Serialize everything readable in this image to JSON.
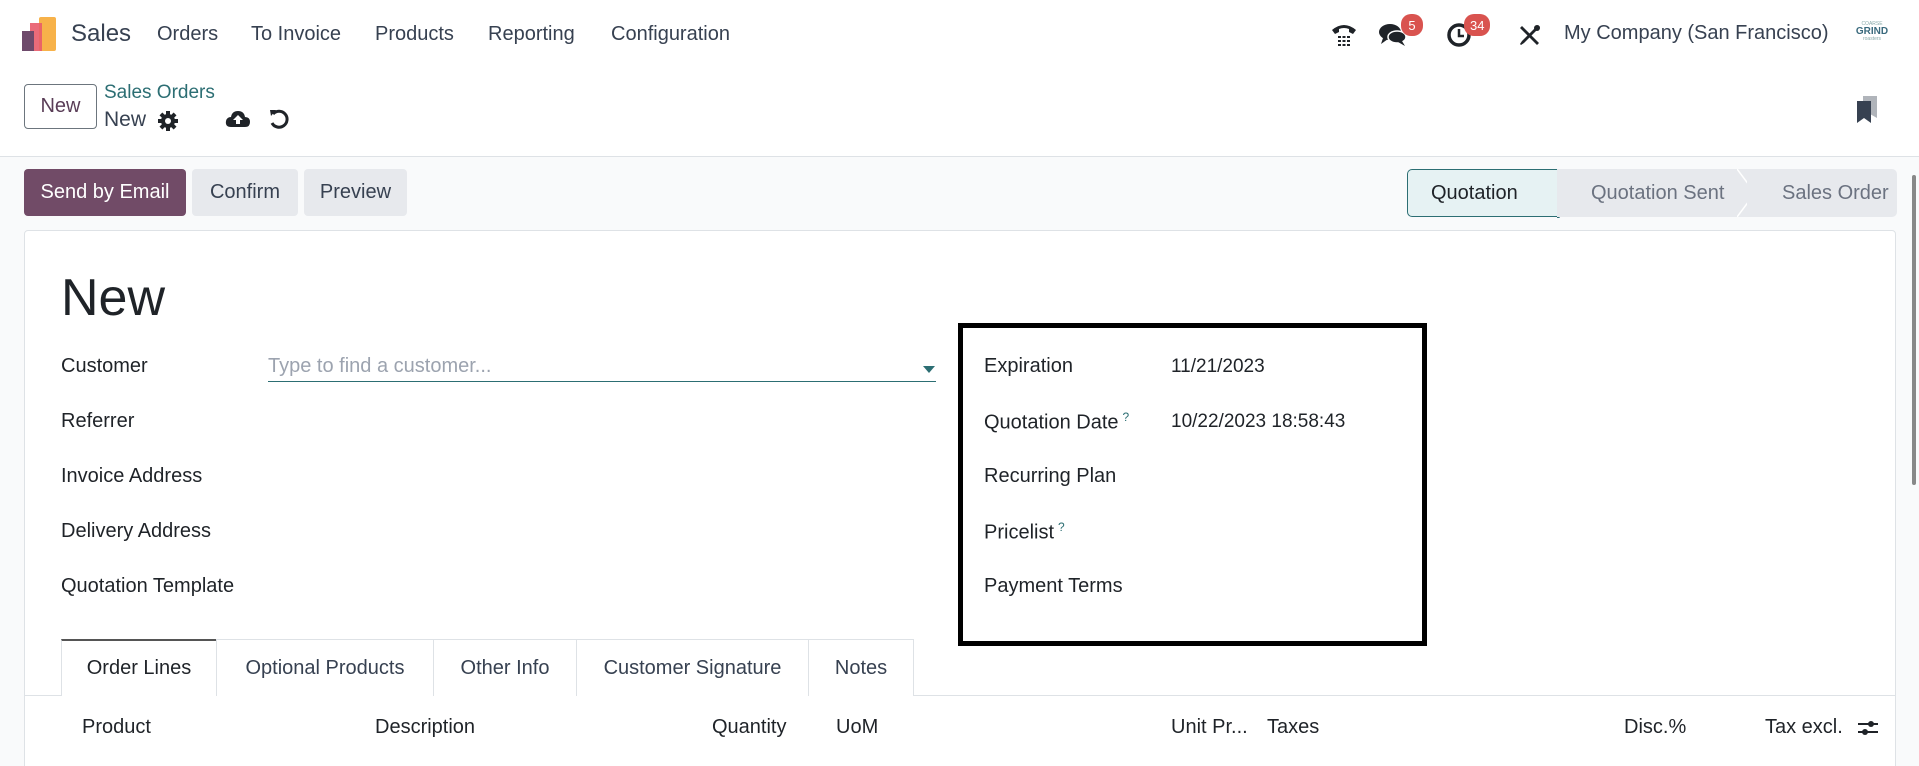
{
  "navbar": {
    "app_name": "Sales",
    "menu": [
      "Orders",
      "To Invoice",
      "Products",
      "Reporting",
      "Configuration"
    ],
    "icons": [
      "phone-icon",
      "chat-icon",
      "activity-clock-icon",
      "debug-tools-icon"
    ],
    "chat_badge": "5",
    "activity_badge": "34",
    "company": "My Company (San Francisco)",
    "user_avatar_text": "GRIND",
    "user_avatar_small_top": "COARSE",
    "user_avatar_small_bottom": "roasters"
  },
  "control_panel": {
    "new_button": "New",
    "breadcrumb_parent": "Sales Orders",
    "breadcrumb_current": "New"
  },
  "actions": {
    "send_email": "Send by Email",
    "confirm": "Confirm",
    "preview": "Preview"
  },
  "statusbar": {
    "steps": [
      "Quotation",
      "Quotation Sent",
      "Sales Order"
    ],
    "active": "Quotation"
  },
  "colors": {
    "primary": "#714b67",
    "accent": "#2c6e73",
    "badge": "#d9534f"
  },
  "form": {
    "title": "New",
    "left_fields": {
      "customer_label": "Customer",
      "customer_placeholder": "Type to find a customer...",
      "referrer_label": "Referrer",
      "invoice_address_label": "Invoice Address",
      "delivery_address_label": "Delivery Address",
      "quotation_template_label": "Quotation Template"
    },
    "right_fields": {
      "expiration_label": "Expiration",
      "expiration_value": "11/21/2023",
      "quotation_date_label": "Quotation Date",
      "quotation_date_value": "10/22/2023 18:58:43",
      "recurring_plan_label": "Recurring Plan",
      "pricelist_label": "Pricelist",
      "payment_terms_label": "Payment Terms",
      "help_mark": "?"
    }
  },
  "tabs": [
    "Order Lines",
    "Optional Products",
    "Other Info",
    "Customer Signature",
    "Notes"
  ],
  "order_lines": {
    "columns": [
      "Product",
      "Description",
      "Quantity",
      "UoM",
      "Unit Pr...",
      "Taxes",
      "Disc.%",
      "Tax excl."
    ]
  }
}
